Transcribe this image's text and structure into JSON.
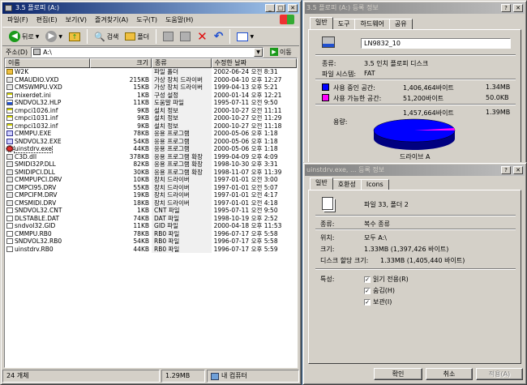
{
  "explorer": {
    "title": "3.5 플로피 (A:)",
    "menu": [
      "파일(F)",
      "편집(E)",
      "보기(V)",
      "즐겨찾기(A)",
      "도구(T)",
      "도움말(H)"
    ],
    "toolbar": {
      "back": "뒤로",
      "search": "검색",
      "folders": "폴더"
    },
    "address": {
      "label": "주소(D)",
      "value": "A:\\",
      "go": "이동"
    },
    "columns": [
      "이름",
      "크기",
      "종류",
      "수정한 날짜"
    ],
    "files": [
      {
        "name": "W2K",
        "size": "",
        "type": "파일 폴더",
        "date": "2002-06-24 오전 8:31",
        "icon": "folder"
      },
      {
        "name": "CMAUDIO.VXD",
        "size": "215KB",
        "type": "가상 장치 드라이버",
        "date": "2000-04-10 오후 12:27",
        "icon": "sys"
      },
      {
        "name": "CMSWMPU.VXD",
        "size": "15KB",
        "type": "가상 장치 드라이버",
        "date": "1999-04-13 오후 5:21",
        "icon": "sys"
      },
      {
        "name": "mixerdet.ini",
        "size": "1KB",
        "type": "구성 설정",
        "date": "2000-01-14 오후 12:21",
        "icon": "ini"
      },
      {
        "name": "SNDVOL32.HLP",
        "size": "11KB",
        "type": "도움말 파일",
        "date": "1995-07-11 오전 9:50",
        "icon": "help"
      },
      {
        "name": "cmpci1026.inf",
        "size": "9KB",
        "type": "설치 정보",
        "date": "2000-10-27 오전 11:11",
        "icon": "ini"
      },
      {
        "name": "cmpci1031.inf",
        "size": "9KB",
        "type": "설치 정보",
        "date": "2000-10-27 오전 11:29",
        "icon": "ini"
      },
      {
        "name": "cmpci1032.inf",
        "size": "9KB",
        "type": "설치 정보",
        "date": "2000-10-27 오전 11:18",
        "icon": "ini"
      },
      {
        "name": "CMMPU.EXE",
        "size": "78KB",
        "type": "응용 프로그램",
        "date": "2000-05-06 오후 1:18",
        "icon": "exe"
      },
      {
        "name": "SNDVOL32.EXE",
        "size": "54KB",
        "type": "응용 프로그램",
        "date": "2000-05-06 오후 1:18",
        "icon": "exe"
      },
      {
        "name": "uinstdrv.exe",
        "size": "44KB",
        "type": "응용 프로그램",
        "date": "2000-05-06 오후 1:18",
        "icon": "setup",
        "selected": true
      },
      {
        "name": "C3D.dll",
        "size": "378KB",
        "type": "응용 프로그램 확장",
        "date": "1999-04-09 오후 4:09",
        "icon": "sys"
      },
      {
        "name": "SMIDI32P.DLL",
        "size": "82KB",
        "type": "응용 프로그램 확장",
        "date": "1998-10-30 오후 3:31",
        "icon": "sys"
      },
      {
        "name": "SMIDIPCI.DLL",
        "size": "30KB",
        "type": "응용 프로그램 확장",
        "date": "1998-11-07 오후 11:39",
        "icon": "sys"
      },
      {
        "name": "CMMPUPCI.DRV",
        "size": "10KB",
        "type": "장치 드라이버",
        "date": "1997-01-01 오전 3:00",
        "icon": "sys"
      },
      {
        "name": "CMPCI95.DRV",
        "size": "55KB",
        "type": "장치 드라이버",
        "date": "1997-01-01 오전 5:07",
        "icon": "sys"
      },
      {
        "name": "CMPCIFM.DRV",
        "size": "19KB",
        "type": "장치 드라이버",
        "date": "1997-01-01 오전 4:17",
        "icon": "sys"
      },
      {
        "name": "CMSMIDI.DRV",
        "size": "18KB",
        "type": "장치 드라이버",
        "date": "1997-01-01 오전 4:18",
        "icon": "sys"
      },
      {
        "name": "SNDVOL32.CNT",
        "size": "1KB",
        "type": "CNT 파일",
        "date": "1995-07-11 오전 9:50",
        "icon": "doc"
      },
      {
        "name": "DLSTABLE.DAT",
        "size": "74KB",
        "type": "DAT 파일",
        "date": "1998-10-19 오후 2:52",
        "icon": "doc"
      },
      {
        "name": "sndvol32.GID",
        "size": "11KB",
        "type": "GID 파일",
        "date": "2000-04-18 오후 11:53",
        "icon": "doc"
      },
      {
        "name": "CMMPU.RB0",
        "size": "78KB",
        "type": "RB0 파일",
        "date": "1996-07-17 오후 5:58",
        "icon": "doc"
      },
      {
        "name": "SNDVOL32.RB0",
        "size": "54KB",
        "type": "RB0 파일",
        "date": "1996-07-17 오후 5:58",
        "icon": "doc"
      },
      {
        "name": "uinstdrv.RB0",
        "size": "44KB",
        "type": "RB0 파일",
        "date": "1996-07-17 오후 5:59",
        "icon": "doc"
      }
    ],
    "status": {
      "count": "24 개체",
      "size": "1.29MB",
      "zone": "내 컴퓨터"
    }
  },
  "floppy_props": {
    "title": "3.5 플로피 (A:) 등록 정보",
    "tabs": [
      "일반",
      "도구",
      "하드웨어",
      "공유"
    ],
    "label_value": "LN9832_10",
    "type_label": "종류:",
    "type_value": "3.5 인치 플로피 디스크",
    "fs_label": "파일 시스템:",
    "fs_value": "FAT",
    "used_label": "사용 중인 공간:",
    "used_bytes": "1,406,464바이트",
    "used_mb": "1.34MB",
    "free_label": "사용 가능한 공간:",
    "free_bytes": "51,200바이트",
    "free_kb": "50.0KB",
    "capacity_label": "용량:",
    "capacity_bytes": "1,457,664바이트",
    "capacity_mb": "1.39MB",
    "drive_label": "드라이브 A",
    "used_fraction": 0.965,
    "colors": {
      "used": "#0000ff",
      "free": "#ff00ff"
    }
  },
  "file_props": {
    "title": "uinstdrv.exe, ... 등록 정보",
    "tabs": [
      "일반",
      "호환성",
      "Icons"
    ],
    "summary": "파일 33, 폴더 2",
    "type_label": "종류:",
    "type_value": "복수 종류",
    "location_label": "위치:",
    "location_value": "모두 A:\\",
    "size_label": "크기:",
    "size_value": "1.33MB (1,397,426 바이트)",
    "disk_label": "디스크 할당 크기:",
    "disk_value": "1.33MB (1,405,440 바이트)",
    "attr_label": "특성:",
    "attrs": [
      "읽기 전용(R)",
      "숨김(H)",
      "보관(I)"
    ],
    "buttons": {
      "ok": "확인",
      "cancel": "취소",
      "apply": "적용(A)"
    }
  }
}
